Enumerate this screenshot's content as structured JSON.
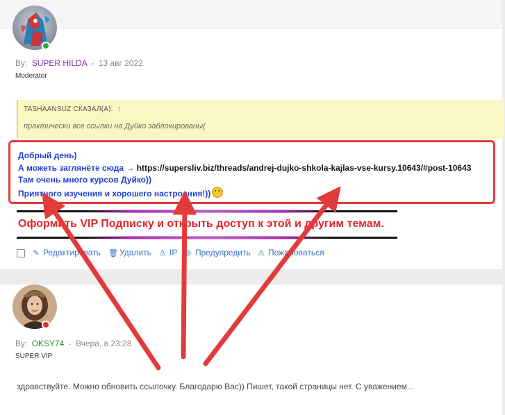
{
  "post1": {
    "by_label": "By:",
    "username": "SUPER HILDA",
    "separator": "-",
    "date": "13 авг 2022",
    "role": "Moderator",
    "quote": {
      "header": "TASHAANSUZ СКАЗАЛ(А):",
      "jump_glyph": "↑",
      "text": "практически все ссылки на Дуйко заблокированы("
    },
    "message": {
      "line1": "Добрый день)",
      "line2_prefix": "А можеть заглянёте сюда →",
      "line2_link": "https://supersliv.biz/threads/andrej-dujko-shkola-kajlas-vse-kursy.10643/#post-10643",
      "line3": "Там очень много курсов Дуйко))",
      "line4": "Приятного изучения и хорошего настроения!))"
    },
    "vip_banner": "Оформить VIP Подписку и открыть доступ к этой и другим темам.",
    "actions": [
      {
        "icon": "✎",
        "label": "Редактировать"
      },
      {
        "icon": "🗑",
        "label": "Удалить"
      },
      {
        "icon": "♙",
        "label": "IP"
      },
      {
        "icon": "⊘",
        "label": "Предупредить"
      },
      {
        "icon": "⚠",
        "label": "Пожаловаться"
      }
    ]
  },
  "post2": {
    "by_label": "By:",
    "username": "OKSY74",
    "separator": "-",
    "date": "Вчера, в 23:28",
    "role": "SUPER VIP",
    "text": "здравствуйте. Можно обновить ссылочку. Благодарю Вас)) Пишет, такой страницы нет. С уважением..."
  },
  "colors": {
    "annotation_red": "#e23b3b",
    "message_blue": "#1f3fd6",
    "vip_red": "#e0252b",
    "online_green": "#2faa3c",
    "offline_red": "#e02d2d"
  }
}
